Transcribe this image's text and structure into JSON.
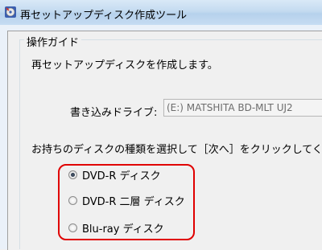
{
  "window": {
    "title": "再セットアップディスク作成ツール"
  },
  "group": {
    "title": "操作ガイド",
    "intro": "再セットアップディスクを作成します。"
  },
  "drive": {
    "label": "書き込みドライブ:",
    "selected": "(E:) MATSHITA BD-MLT UJ2"
  },
  "instruction": "お持ちのディスクの種類を選択して［次へ］をクリックしてくだ",
  "disc_types": [
    {
      "label": "DVD-R ディスク",
      "checked": true
    },
    {
      "label": "DVD-R 二層 ディスク",
      "checked": false
    },
    {
      "label": "Blu-ray ディスク",
      "checked": false
    }
  ],
  "colors": {
    "highlight": "#e00000",
    "titlebar": "#c4dbf0"
  }
}
